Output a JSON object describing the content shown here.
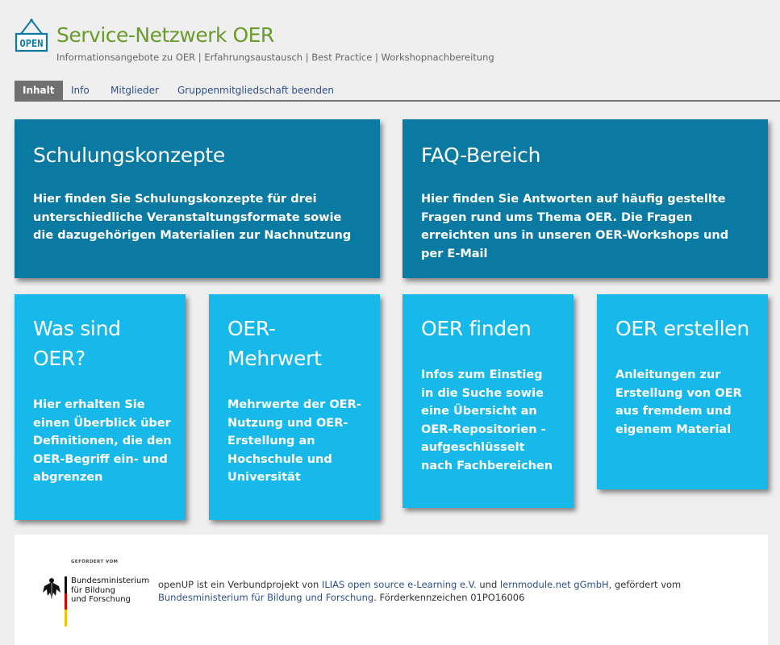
{
  "header": {
    "logo_text": "OPEN",
    "title": "Service-Netzwerk OER",
    "subtitle": "Informationsangebote zu OER | Erfahrungsaustausch | Best Practice | Workshopnachbereitung"
  },
  "tabs": [
    {
      "label": "Inhalt",
      "active": true
    },
    {
      "label": "Info"
    },
    {
      "label": "Mitglieder"
    },
    {
      "label": "Gruppenmitgliedschaft beenden"
    }
  ],
  "tiles": [
    {
      "title": "Schulungskonzepte",
      "body": "Hier finden Sie Schulungskonzepte für drei unterschiedliche Veranstaltungsformate sowie die dazugehörigen Materialien zur Nachnutzung"
    },
    {
      "title": "FAQ-Bereich",
      "body": "Hier finden Sie Antworten auf häufig gestellte Fragen rund ums Thema OER. Die Fragen erreichten uns in unseren OER-Workshops und per E-Mail"
    },
    {
      "title": "Was sind OER?",
      "body": "Hier erhalten Sie einen Überblick über Definitionen, die den OER-Begriff ein- und abgrenzen"
    },
    {
      "title": "OER-Mehrwert",
      "body": "Mehrwerte der OER-Nutzung und OER-Erstellung an Hochschule und Universität"
    },
    {
      "title": "OER finden",
      "body": "Infos zum Einstieg in die Suche sowie eine Übersicht an OER-Repositorien - aufgeschlüsselt nach Fachbereichen"
    },
    {
      "title": "OER erstellen",
      "body": "Anleitungen zur Erstellung von OER aus fremdem und eigenem Material"
    }
  ],
  "footer": {
    "gefoerdert": "GEFÖRDERT VOM",
    "bmbf_lines": [
      "Bundesministerium",
      "für Bildung",
      "und Forschung"
    ],
    "text_1": "openUP ist ein Verbundprojekt von ",
    "link_ilias_1": "ILIAS",
    "link_ilias_2": "open source e-Learning e.V.",
    "text_2": " und ",
    "link_lernmodule": "lernmodule.net gGmbH",
    "text_3": ", gefördert vom ",
    "link_bmbf": "Bundesministerium für Bildung und Forschung",
    "text_4": ". Förderkennzeichen 01PO16006"
  },
  "colors": {
    "title_green": "#6a9a2b",
    "tile_dark": "#0a7aa3",
    "tile_light": "#17b9eb",
    "tab_active_bg": "#707070",
    "link_blue": "#2e4f8a"
  },
  "icons": {
    "logo": "open-sign-icon",
    "footer_emblem": "federal-eagle-icon",
    "footer_flag": "german-flag-icon"
  }
}
